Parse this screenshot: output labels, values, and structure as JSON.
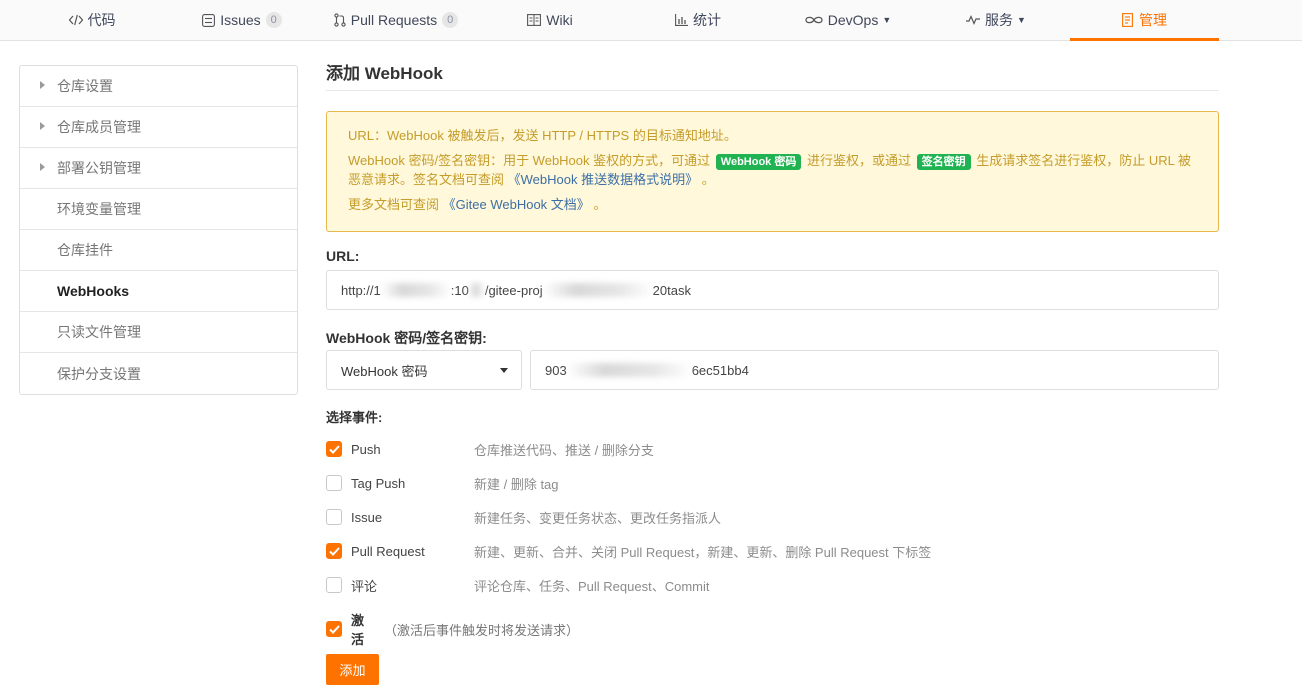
{
  "nav": {
    "tabs": [
      {
        "label": "代码",
        "icon": "code-icon"
      },
      {
        "label": "Issues",
        "icon": "issues-icon",
        "count": "0"
      },
      {
        "label": "Pull Requests",
        "icon": "pull-request-icon",
        "count": "0"
      },
      {
        "label": "Wiki",
        "icon": "wiki-icon"
      },
      {
        "label": "统计",
        "icon": "stats-icon"
      },
      {
        "label": "DevOps",
        "icon": "devops-icon"
      },
      {
        "label": "服务",
        "icon": "service-icon"
      },
      {
        "label": "管理",
        "icon": "manage-icon",
        "active": true
      }
    ],
    "accent": "#fe7300"
  },
  "sidebar": {
    "items": [
      {
        "label": "仓库设置"
      },
      {
        "label": "仓库成员管理"
      },
      {
        "label": "部署公钥管理"
      },
      {
        "label": "环境变量管理"
      },
      {
        "label": "仓库挂件"
      },
      {
        "label": "WebHooks"
      },
      {
        "label": "只读文件管理"
      },
      {
        "label": "保护分支设置"
      }
    ]
  },
  "main": {
    "title": "添加 WebHook",
    "notice": {
      "line1": "URL：WebHook 被触发后，发送 HTTP / HTTPS 的目标通知地址。",
      "line2_a": "WebHook 密码/签名密钥：用于 WebHook 鉴权的方式，可通过",
      "badge1": "WebHook 密码",
      "line2_b": "进行鉴权，或通过",
      "badge2": "签名密钥",
      "line2_c": "生成请求签名进行鉴权，防止 URL 被恶意请求。签名文档可查阅",
      "link1": "《WebHook 推送数据格式说明》",
      "line2_d": "。",
      "line3_a": "更多文档可查阅",
      "link2": "《Gitee WebHook 文档》",
      "line3_b": "。"
    },
    "url": {
      "label": "URL:",
      "value_start": "http://1",
      "value_mid1": ":10",
      "value_mid2": "/gitee-proj",
      "value_end": "20task"
    },
    "secret": {
      "label": "WebHook 密码/签名密钥:",
      "type_selected": "WebHook 密码",
      "value_start": "903",
      "value_end": "6ec51bb4"
    },
    "events": {
      "label": "选择事件:",
      "items": [
        {
          "name": "Push",
          "desc": "仓库推送代码、推送 / 删除分支",
          "checked": true
        },
        {
          "name": "Tag Push",
          "desc": "新建 / 删除 tag",
          "checked": false
        },
        {
          "name": "Issue",
          "desc": "新建任务、变更任务状态、更改任务指派人",
          "checked": false
        },
        {
          "name": "Pull Request",
          "desc": "新建、更新、合并、关闭 Pull Request，新建、更新、删除 Pull Request 下标签",
          "checked": true
        },
        {
          "name": "评论",
          "desc": "评论仓库、任务、Pull Request、Commit",
          "checked": false
        }
      ]
    },
    "activate": {
      "label": "激活",
      "hint": "（激活后事件触发时将发送请求）",
      "checked": true
    },
    "submit_label": "添加"
  }
}
